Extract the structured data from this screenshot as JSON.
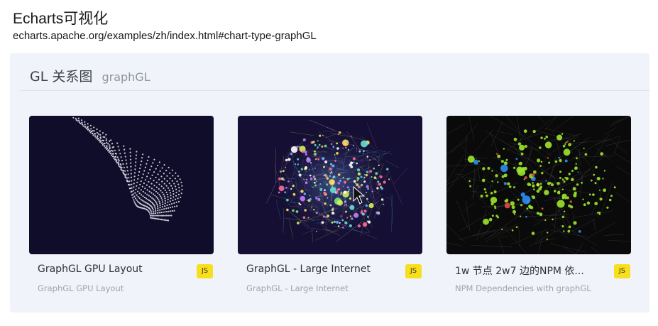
{
  "slide": {
    "title": "Echarts可视化",
    "url": "echarts.apache.org/examples/zh/index.html#chart-type-graphGL"
  },
  "section": {
    "title": "GL 关系图",
    "subtitle": "graphGL"
  },
  "cards": [
    {
      "title": "GraphGL GPU Layout",
      "description": "GraphGL GPU Layout",
      "badge": "JS",
      "thumbnail_bg": "#100d2a"
    },
    {
      "title": "GraphGL - Large Internet",
      "description": "GraphGL - Large Internet",
      "badge": "JS",
      "thumbnail_bg": "#150f33"
    },
    {
      "title": "1w 节点 2w7 边的NPM 依...",
      "description": "NPM Dependencies with graphGL",
      "badge": "JS",
      "thumbnail_bg": "#0a0a0a"
    }
  ],
  "colors": {
    "panel_bg": "#f1f3fa",
    "badge_yellow": "#f7df1e"
  }
}
